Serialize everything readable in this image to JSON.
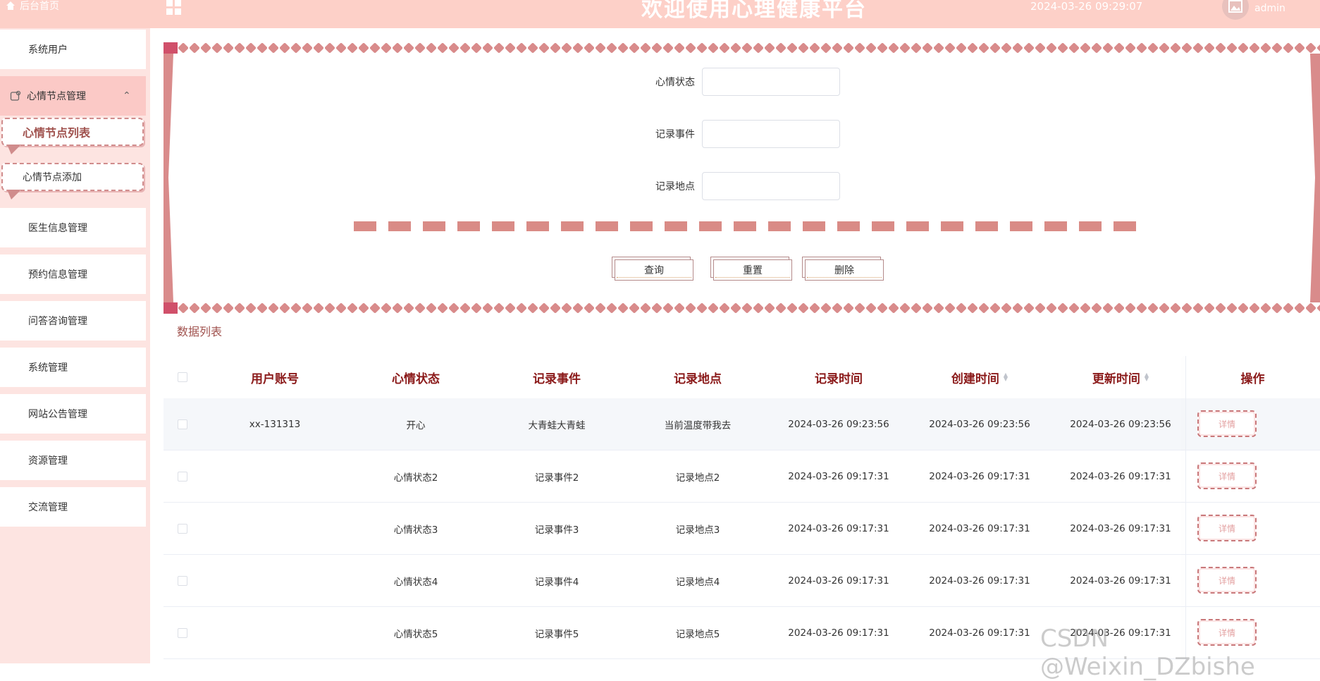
{
  "header": {
    "home_label": "后台首页",
    "title": "欢迎使用心理健康平台",
    "datetime": "2024-03-26 09:29:07",
    "username": "admin"
  },
  "sidebar": {
    "items": [
      {
        "label": "系统用户"
      },
      {
        "label": "心情节点管理"
      },
      {
        "label": "心情节点列表"
      },
      {
        "label": "心情节点添加"
      },
      {
        "label": "医生信息管理"
      },
      {
        "label": "预约信息管理"
      },
      {
        "label": "问答咨询管理"
      },
      {
        "label": "系统管理"
      },
      {
        "label": "网站公告管理"
      },
      {
        "label": "资源管理"
      },
      {
        "label": "交流管理"
      }
    ]
  },
  "search": {
    "fields": [
      {
        "label": "心情状态",
        "value": ""
      },
      {
        "label": "记录事件",
        "value": ""
      },
      {
        "label": "记录地点",
        "value": ""
      }
    ],
    "buttons": {
      "query": "查询",
      "reset": "重置",
      "delete": "删除"
    }
  },
  "list_title": "数据列表",
  "table": {
    "columns": [
      "用户账号",
      "心情状态",
      "记录事件",
      "记录地点",
      "记录时间",
      "创建时间",
      "更新时间",
      "操作"
    ],
    "rows": [
      {
        "account": "xx-131313",
        "mood": "开心",
        "event": "大青蛙大青蛙",
        "place": "当前温度带我去",
        "record_time": "2024-03-26 09:23:56",
        "created": "2024-03-26 09:23:56",
        "updated": "2024-03-26 09:23:56",
        "action": "详情"
      },
      {
        "account": "",
        "mood": "心情状态2",
        "event": "记录事件2",
        "place": "记录地点2",
        "record_time": "2024-03-26 09:17:31",
        "created": "2024-03-26 09:17:31",
        "updated": "2024-03-26 09:17:31",
        "action": "详情"
      },
      {
        "account": "",
        "mood": "心情状态3",
        "event": "记录事件3",
        "place": "记录地点3",
        "record_time": "2024-03-26 09:17:31",
        "created": "2024-03-26 09:17:31",
        "updated": "2024-03-26 09:17:31",
        "action": "详情"
      },
      {
        "account": "",
        "mood": "心情状态4",
        "event": "记录事件4",
        "place": "记录地点4",
        "record_time": "2024-03-26 09:17:31",
        "created": "2024-03-26 09:17:31",
        "updated": "2024-03-26 09:17:31",
        "action": "详情"
      },
      {
        "account": "",
        "mood": "心情状态5",
        "event": "记录事件5",
        "place": "记录地点5",
        "record_time": "2024-03-26 09:17:31",
        "created": "2024-03-26 09:17:31",
        "updated": "2024-03-26 09:17:31",
        "action": "详情"
      }
    ]
  },
  "watermark": "CSDN @Weixin_DZbishe",
  "colors": {
    "header_bg": "#fdd0c8",
    "sidebar_bg": "#fde4e1",
    "accent": "#a0524e",
    "deco": "#d98b8b"
  }
}
